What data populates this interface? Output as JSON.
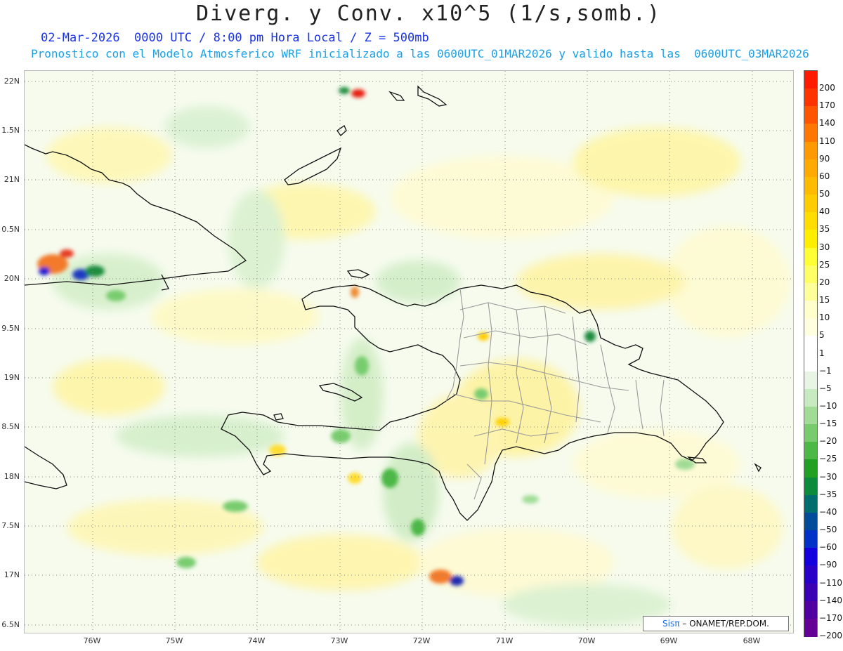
{
  "title": "Diverg. y Conv. x10^5 (1/s,somb.)",
  "subtitle_line1": "02-Mar-2026  0000 UTC / 8:00 pm Hora Local / Z = 500mb",
  "subtitle_line2": "Pronostico con el Modelo Atmosferico WRF inicializado a las 0600UTC_01MAR2026 y valido hasta las  0600UTC_03MAR2026",
  "lat_labels": [
    "22N",
    "1.5N",
    "21N",
    "0.5N",
    "20N",
    "9.5N",
    "19N",
    "8.5N",
    "18N",
    "7.5N",
    "17N",
    "6.5N"
  ],
  "lon_labels": [
    "76W",
    "75W",
    "74W",
    "73W",
    "72W",
    "71W",
    "70W",
    "69W",
    "68W"
  ],
  "credit": {
    "sis": "Sisπ",
    "text": "–  ONAMET/REP.DOM."
  },
  "colorbar": {
    "labels": [
      "200",
      "170",
      "140",
      "110",
      "90",
      "60",
      "50",
      "40",
      "35",
      "30",
      "25",
      "20",
      "15",
      "10",
      "5",
      "1",
      "−1",
      "−5",
      "−10",
      "−15",
      "−20",
      "−25",
      "−30",
      "−35",
      "−40",
      "−50",
      "−60",
      "−90",
      "−110",
      "−140",
      "−170",
      "−200"
    ],
    "colors": [
      "#ff1a00",
      "#ff3300",
      "#ff5500",
      "#ff7700",
      "#ff9900",
      "#ffaa00",
      "#ffbb00",
      "#ffcc00",
      "#ffdd00",
      "#ffee00",
      "#ffff33",
      "#ffff66",
      "#ffff99",
      "#ffffcc",
      "#ffffe0",
      "#ffffff",
      "#ffffff",
      "#e8f5e4",
      "#c8eac0",
      "#a0dc96",
      "#78cc6e",
      "#4cb846",
      "#22a022",
      "#0a8c3c",
      "#006e6e",
      "#004c9a",
      "#0032c8",
      "#1400dc",
      "#2800c8",
      "#3c00b4",
      "#5000a0",
      "#640096"
    ]
  }
}
